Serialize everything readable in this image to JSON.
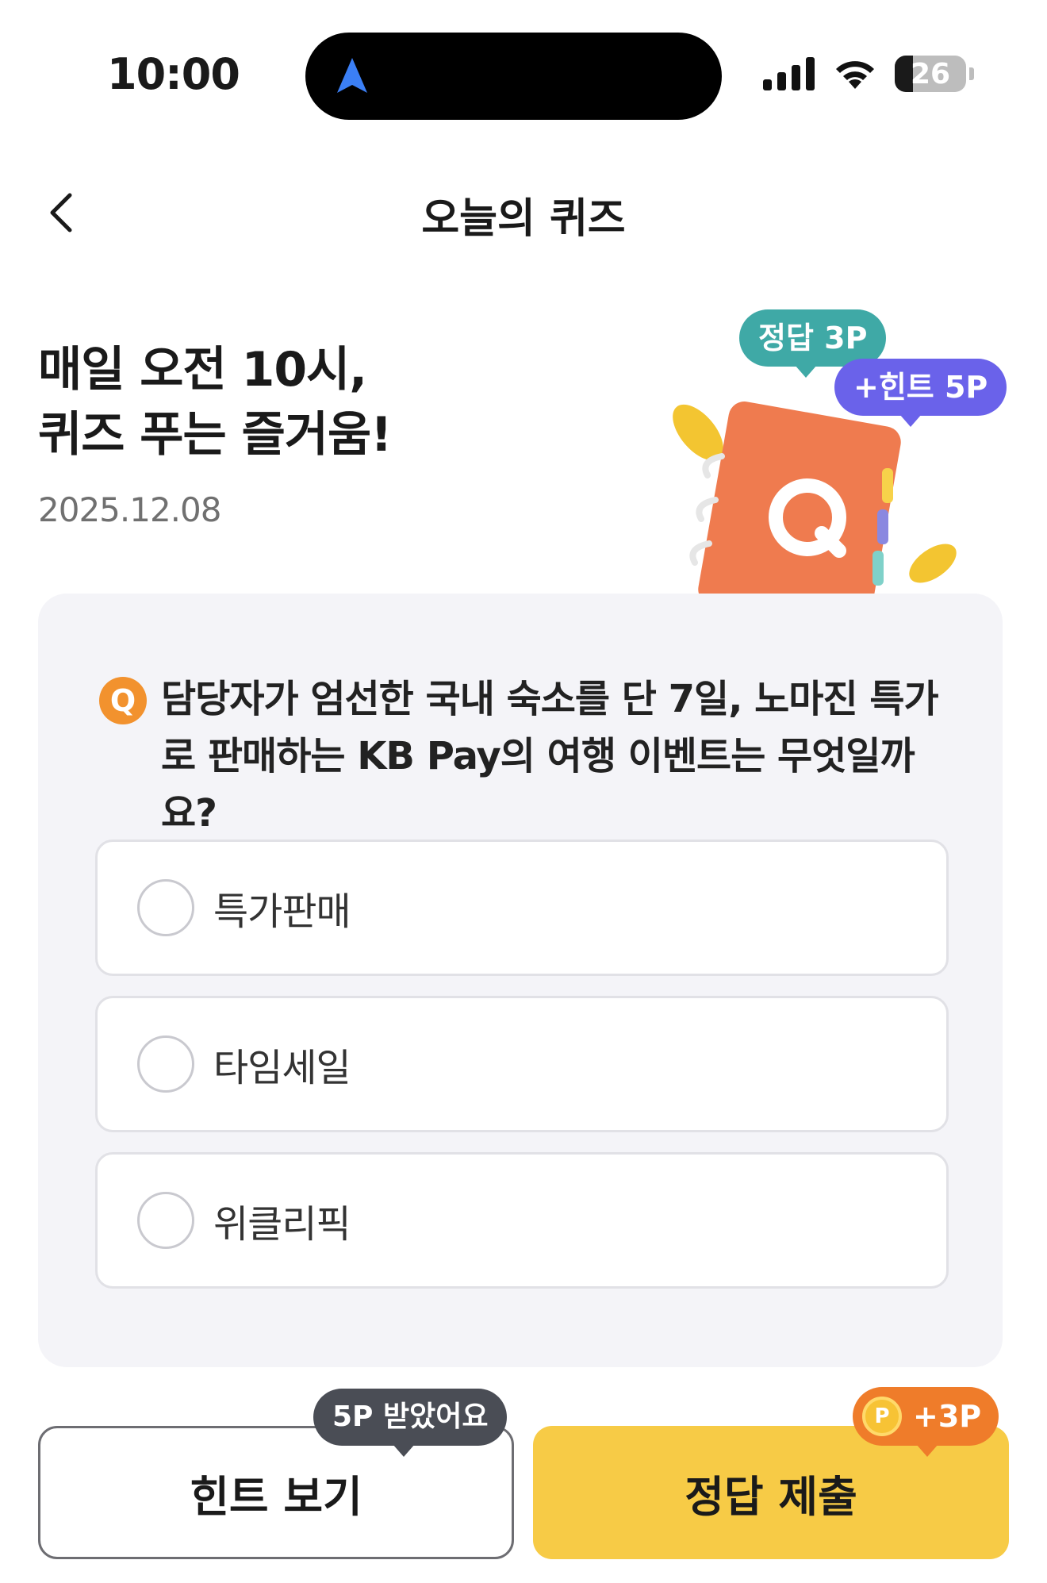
{
  "status_bar": {
    "time": "10:00",
    "battery": "26",
    "icons": [
      "navigation-arrow-icon",
      "signal-icon",
      "wifi-icon",
      "battery-icon"
    ]
  },
  "header": {
    "title": "오늘의 퀴즈",
    "back_icon": "chevron-left-icon"
  },
  "hero": {
    "title_line1": "매일 오전 10시,",
    "title_line2": "퀴즈 푸는 즐거움!",
    "date": "2025.12.08",
    "badge_answer": "정답 3P",
    "badge_hint": "+힌트 5P",
    "illustration_letter": "Q"
  },
  "quiz": {
    "badge": "Q",
    "question": "담당자가 엄선한 국내 숙소를 단 7일, 노마진 특가로 판매하는 KB Pay의 여행 이벤트는 무엇일까요?",
    "options": [
      {
        "label": "특가판매",
        "selected": false
      },
      {
        "label": "타임세일",
        "selected": false
      },
      {
        "label": "위클리픽",
        "selected": false
      }
    ]
  },
  "actions": {
    "hint_label": "힌트 보기",
    "hint_tooltip": "5P 받았어요",
    "submit_label": "정답 제출",
    "reward_tooltip": "+3P",
    "coin_letter": "P"
  },
  "colors": {
    "accent_yellow": "#f7cb46",
    "answer_badge": "#3fa9a6",
    "hint_badge": "#6a62ea",
    "q_badge": "#f2922e",
    "reward_badge": "#ef7c2a"
  }
}
